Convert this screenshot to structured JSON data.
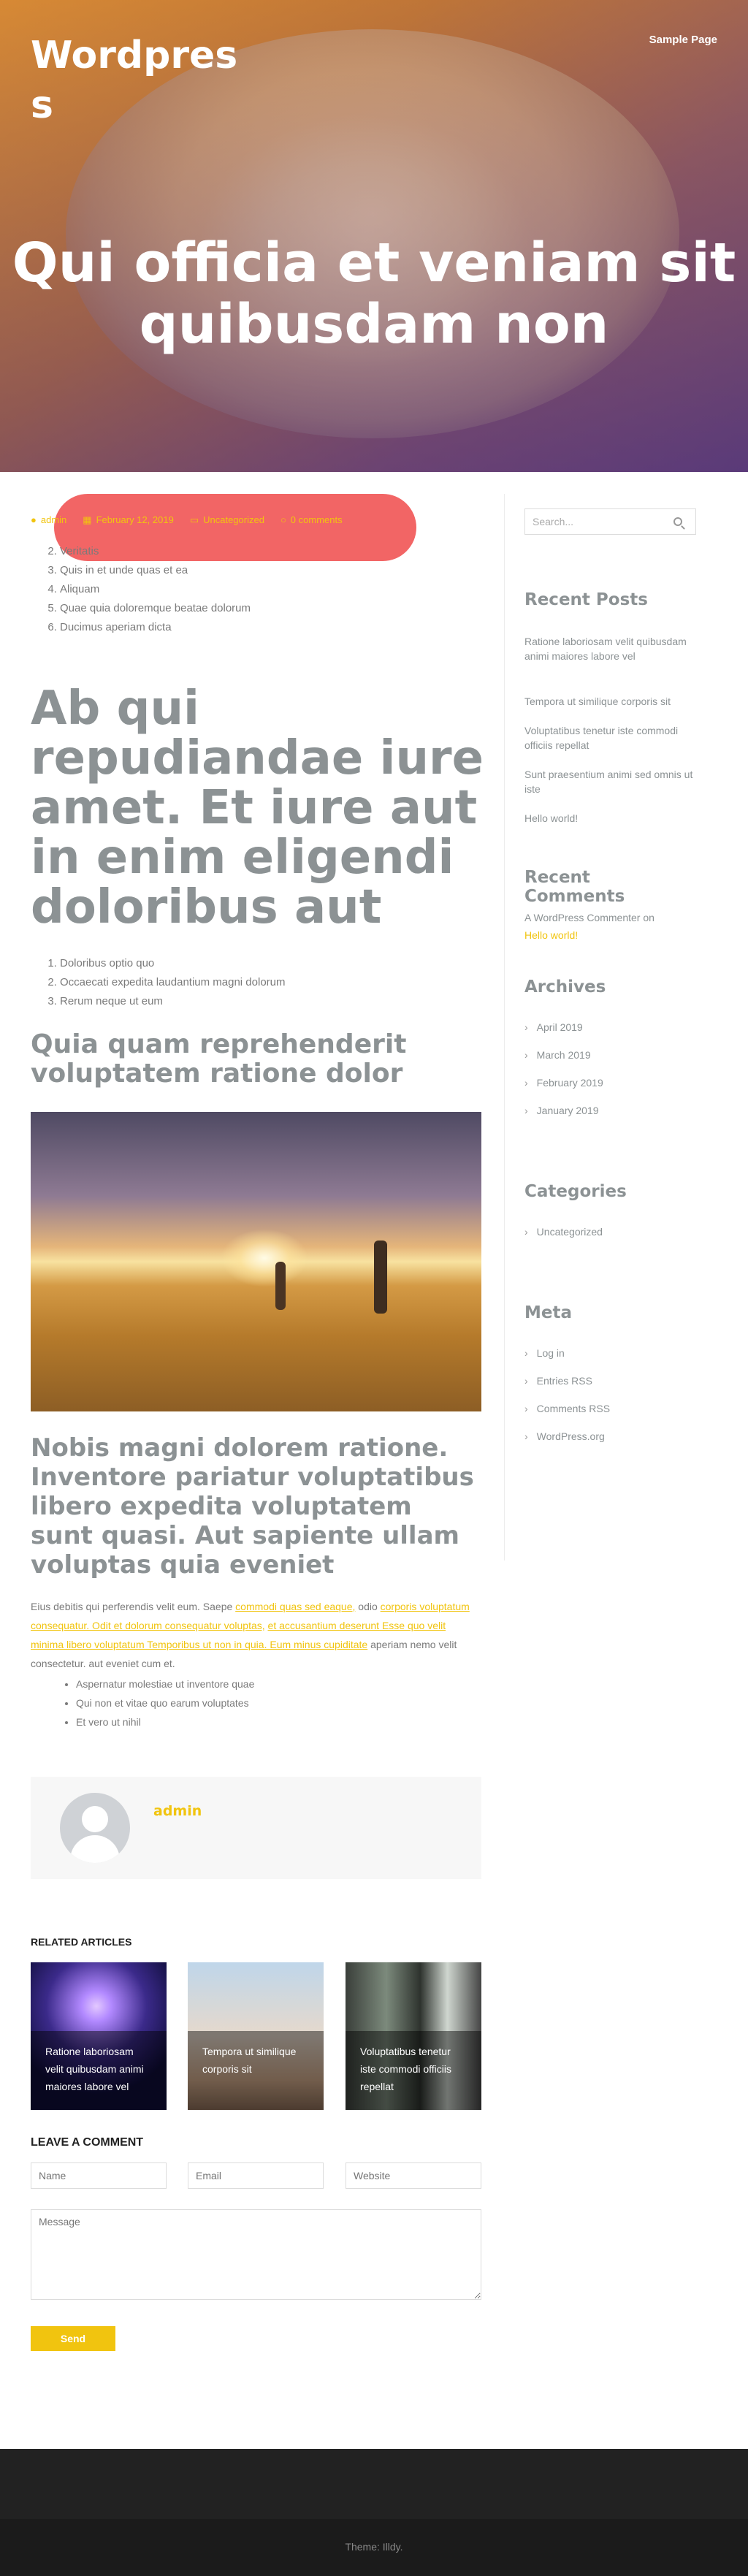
{
  "site": {
    "title": "Wordpress",
    "nav_sample_page": "Sample Page"
  },
  "hero": {
    "title": "Qui officia et veniam sit quibusdam non"
  },
  "post": {
    "meta": {
      "author": "admin",
      "date": "February 12, 2019",
      "category": "Uncategorized",
      "comments": "0 comments"
    },
    "list1": [
      "Veritatis",
      "Quis in et unde quas et ea",
      "Aliquam",
      "Quae quia doloremque beatae dolorum",
      "Ducimus aperiam dicta"
    ],
    "heading1": "Ab qui repudiandae iure amet. Et iure aut in enim eligendi doloribus aut",
    "list2": [
      "Doloribus optio quo",
      "Occaecati expedita laudantium magni dolorum",
      "Rerum neque ut eum"
    ],
    "heading2": "Quia quam reprehenderit voluptatem ratione dolor",
    "heading3": "Nobis magni dolorem ratione. Inventore pariatur voluptatibus libero expedita voluptatem sunt quasi. Aut sapiente ullam voluptas quia eveniet",
    "paragraph": {
      "t1": "Eius debitis qui perferendis velit eum. Saepe ",
      "l1": "commodi quas sed eaque,",
      "t2": " odio ",
      "l2": "corporis voluptatum consequatur. Odit et dolorum consequatur voluptas,",
      "t3": " ",
      "l3": "et accusantium deserunt Esse quo velit minima libero voluptatum Temporibus ut non in quia. Eum minus cupiditate",
      "t4": " aperiam nemo velit consectetur. aut eveniet cum et."
    },
    "list3": [
      "Aspernatur molestiae ut inventore quae",
      "Qui non et vitae quo earum voluptates",
      "Et vero ut nihil"
    ]
  },
  "author_box": {
    "name": "admin"
  },
  "related": {
    "heading": "RELATED ARTICLES",
    "items": [
      {
        "caption": "Ratione laboriosam velit quibusdam animi maiores labore vel"
      },
      {
        "caption": "Tempora ut similique corporis sit"
      },
      {
        "caption": "Voluptatibus tenetur iste commodi officiis repellat"
      }
    ]
  },
  "comment_form": {
    "heading": "LEAVE A COMMENT",
    "name_placeholder": "Name",
    "email_placeholder": "Email",
    "website_placeholder": "Website",
    "message_placeholder": "Message",
    "send_label": "Send"
  },
  "sidebar": {
    "search_placeholder": "Search...",
    "recent_posts": {
      "heading": "Recent Posts",
      "items": [
        "Ratione laboriosam velit quibusdam animi maiores labore vel",
        "Tempora ut similique corporis sit",
        "Voluptatibus tenetur iste commodi officiis repellat",
        "Sunt praesentium animi sed omnis ut iste",
        "Hello world!"
      ]
    },
    "recent_comments": {
      "heading": "Recent Comments",
      "commenter": "A WordPress Commenter on",
      "post": "Hello world!"
    },
    "archives": {
      "heading": "Archives",
      "items": [
        "April 2019",
        "March 2019",
        "February 2019",
        "January 2019"
      ]
    },
    "categories": {
      "heading": "Categories",
      "items": [
        "Uncategorized"
      ]
    },
    "meta": {
      "heading": "Meta",
      "items": [
        "Log in",
        "Entries RSS",
        "Comments RSS",
        "WordPress.org"
      ]
    }
  },
  "footer": {
    "credit": "Theme: Illdy."
  },
  "colors": {
    "accent": "#f1c40f",
    "heading_gray": "#8c9294",
    "footer_bg": "#222222"
  }
}
